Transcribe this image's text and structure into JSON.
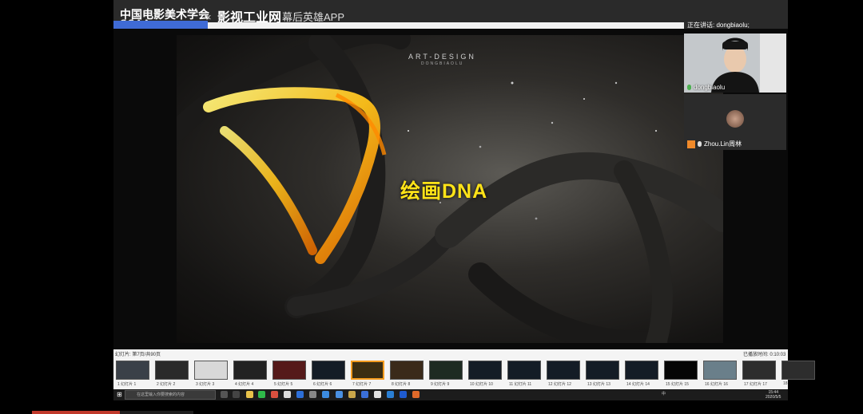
{
  "header": {
    "brand_cn": "中国电影美术学会",
    "brand_en": "CCAA",
    "separator": "×",
    "brand_2": "影视工业网",
    "brand_3": "幕后英雄APP"
  },
  "meeting": {
    "speaking_label": "正在讲话: dongbiaolu;",
    "participants": [
      {
        "name": "dongbiaolu"
      },
      {
        "name": "Zhou.Lin周林"
      }
    ]
  },
  "slide": {
    "header_text": "ART-DESIGN",
    "header_sub": "DONGBIAOLU",
    "title": "绘画DNA"
  },
  "slide_strip": {
    "info": "幻灯片: 第7页/共90页",
    "elapsed": "已播放时间: 0:10:03",
    "thumbnails": [
      {
        "caption": "1 幻灯片 1"
      },
      {
        "caption": "2 幻灯片 2"
      },
      {
        "caption": "3 幻灯片 3"
      },
      {
        "caption": "4 幻灯片 4"
      },
      {
        "caption": "5 幻灯片 5"
      },
      {
        "caption": "6 幻灯片 6"
      },
      {
        "caption": "7 幻灯片 7"
      },
      {
        "caption": "8 幻灯片 8"
      },
      {
        "caption": "9 幻灯片 9"
      },
      {
        "caption": "10 幻灯片 10"
      },
      {
        "caption": "11 幻灯片 11"
      },
      {
        "caption": "12 幻灯片 12"
      },
      {
        "caption": "13 幻灯片 13"
      },
      {
        "caption": "14 幻灯片 14"
      },
      {
        "caption": "15 幻灯片 15"
      },
      {
        "caption": "16 幻灯片 16"
      },
      {
        "caption": "17 幻灯片 17"
      },
      {
        "caption": "18"
      }
    ],
    "active_index": 6
  },
  "taskbar": {
    "search_placeholder": "在这里输入你要搜索的内容",
    "tray_text": "中",
    "time": "15:44",
    "date": "2020/5/5"
  },
  "colors": {
    "accent_blue": "#3f6bd6",
    "title_yellow": "#ffe318",
    "active_border": "#f39c1f"
  }
}
